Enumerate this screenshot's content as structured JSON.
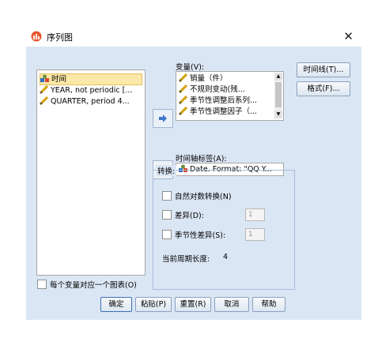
{
  "window": {
    "title": "序列图",
    "close_glyph": "✕"
  },
  "source_list": {
    "items": [
      {
        "label": "时间",
        "icon": "date-variable-icon",
        "selected": true
      },
      {
        "label": "YEAR, not periodic [...",
        "icon": "scale-variable-icon",
        "selected": false
      },
      {
        "label": "QUARTER, period 4...",
        "icon": "scale-variable-icon",
        "selected": false
      }
    ]
  },
  "variables": {
    "label": "变量(V):",
    "items": [
      {
        "label": "销量（件）",
        "icon": "scale-variable-icon"
      },
      {
        "label": "不规则变动(残...",
        "icon": "scale-variable-icon"
      },
      {
        "label": "季节性调整后系列...",
        "icon": "scale-variable-icon"
      },
      {
        "label": "季节性调整因子（...",
        "icon": "scale-variable-icon"
      }
    ]
  },
  "time_axis": {
    "label": "时间轴标签(A):",
    "value": "Date.  Format: \"QQ Y..."
  },
  "side_buttons": {
    "time_lines": "时间线(T)...",
    "format": "格式(F)..."
  },
  "transform": {
    "legend": "转换:",
    "natural_log": {
      "label": "自然对数转换(N)",
      "checked": false
    },
    "difference": {
      "label": "差异(D):",
      "checked": false,
      "value": "1"
    },
    "seasonal_difference": {
      "label": "季节性差异(S):",
      "checked": false,
      "value": "1"
    },
    "current_period_label": "当前周期长度:",
    "current_period_value": "4"
  },
  "one_chart_per_variable": {
    "label": "每个变量对应一个图表(O)",
    "checked": false
  },
  "footer_buttons": {
    "ok": "确定",
    "paste": "粘贴(P)",
    "reset": "重置(R)",
    "cancel": "取消",
    "help": "帮助"
  },
  "colors": {
    "dialog_body": "#dbe6f4",
    "selection": "#fce8a8",
    "arrow_button": "#3d78c8",
    "pencil": "#d4a20c"
  }
}
